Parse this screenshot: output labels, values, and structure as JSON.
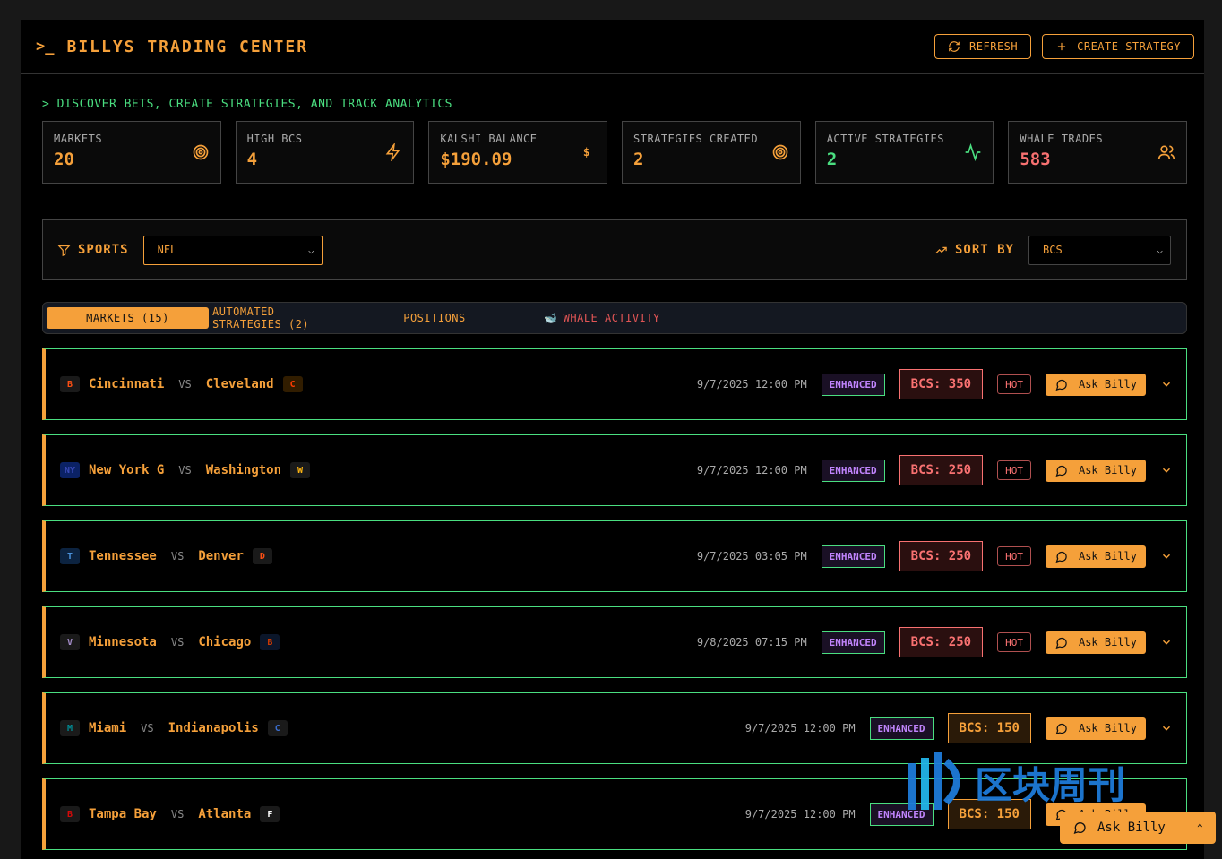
{
  "header": {
    "prompt_icon": "terminal-prompt-icon",
    "title": "BILLYS TRADING CENTER",
    "refresh_label": "REFRESH",
    "create_label": "CREATE STRATEGY"
  },
  "subtitle": "> DISCOVER BETS, CREATE STRATEGIES, AND TRACK ANALYTICS",
  "stats": [
    {
      "label": "MARKETS",
      "value": "20",
      "icon": "target-icon",
      "color": "#f5a03a"
    },
    {
      "label": "HIGH BCS",
      "value": "4",
      "icon": "lightning-icon",
      "color": "#f5a03a"
    },
    {
      "label": "KALSHI BALANCE",
      "value": "$190.09",
      "icon": "dollar-icon",
      "color": "#f5a03a"
    },
    {
      "label": "STRATEGIES CREATED",
      "value": "2",
      "icon": "target-icon",
      "color": "#f5a03a"
    },
    {
      "label": "ACTIVE STRATEGIES",
      "value": "2",
      "icon": "activity-icon",
      "color": "#4ade80"
    },
    {
      "label": "WHALE TRADES",
      "value": "583",
      "icon": "users-icon",
      "color": "#f87171"
    }
  ],
  "filters": {
    "sports_label": "SPORTS",
    "sports_value": "NFL",
    "sort_label": "SORT BY",
    "sort_value": "BCS"
  },
  "tabs": [
    {
      "label": "MARKETS (15)"
    },
    {
      "label": "AUTOMATED STRATEGIES (2)"
    },
    {
      "label": "POSITIONS"
    },
    {
      "label": "WHALE ACTIVITY"
    }
  ],
  "markets": [
    {
      "home": "Cincinnati",
      "away": "Cleveland",
      "date": "9/7/2025 12:00 PM",
      "tag": "ENHANCED",
      "bcs": "BCS: 350",
      "hot": "HOT",
      "ask": "Ask Billy",
      "level": "high"
    },
    {
      "home": "New York G",
      "away": "Washington",
      "date": "9/7/2025 12:00 PM",
      "tag": "ENHANCED",
      "bcs": "BCS: 250",
      "hot": "HOT",
      "ask": "Ask Billy",
      "level": "high"
    },
    {
      "home": "Tennessee",
      "away": "Denver",
      "date": "9/7/2025 03:05 PM",
      "tag": "ENHANCED",
      "bcs": "BCS: 250",
      "hot": "HOT",
      "ask": "Ask Billy",
      "level": "high"
    },
    {
      "home": "Minnesota",
      "away": "Chicago",
      "date": "9/8/2025 07:15 PM",
      "tag": "ENHANCED",
      "bcs": "BCS: 250",
      "hot": "HOT",
      "ask": "Ask Billy",
      "level": "high"
    },
    {
      "home": "Miami",
      "away": "Indianapolis",
      "date": "9/7/2025 12:00 PM",
      "tag": "ENHANCED",
      "bcs": "BCS: 150",
      "hot": "",
      "ask": "Ask Billy",
      "level": "med"
    },
    {
      "home": "Tampa Bay",
      "away": "Atlanta",
      "date": "9/7/2025 12:00 PM",
      "tag": "ENHANCED",
      "bcs": "BCS: 150",
      "hot": "",
      "ask": "Ask Billy",
      "level": "med"
    }
  ],
  "floating": {
    "label": "Ask Billy"
  },
  "watermark": {
    "text": "区块周刊"
  }
}
